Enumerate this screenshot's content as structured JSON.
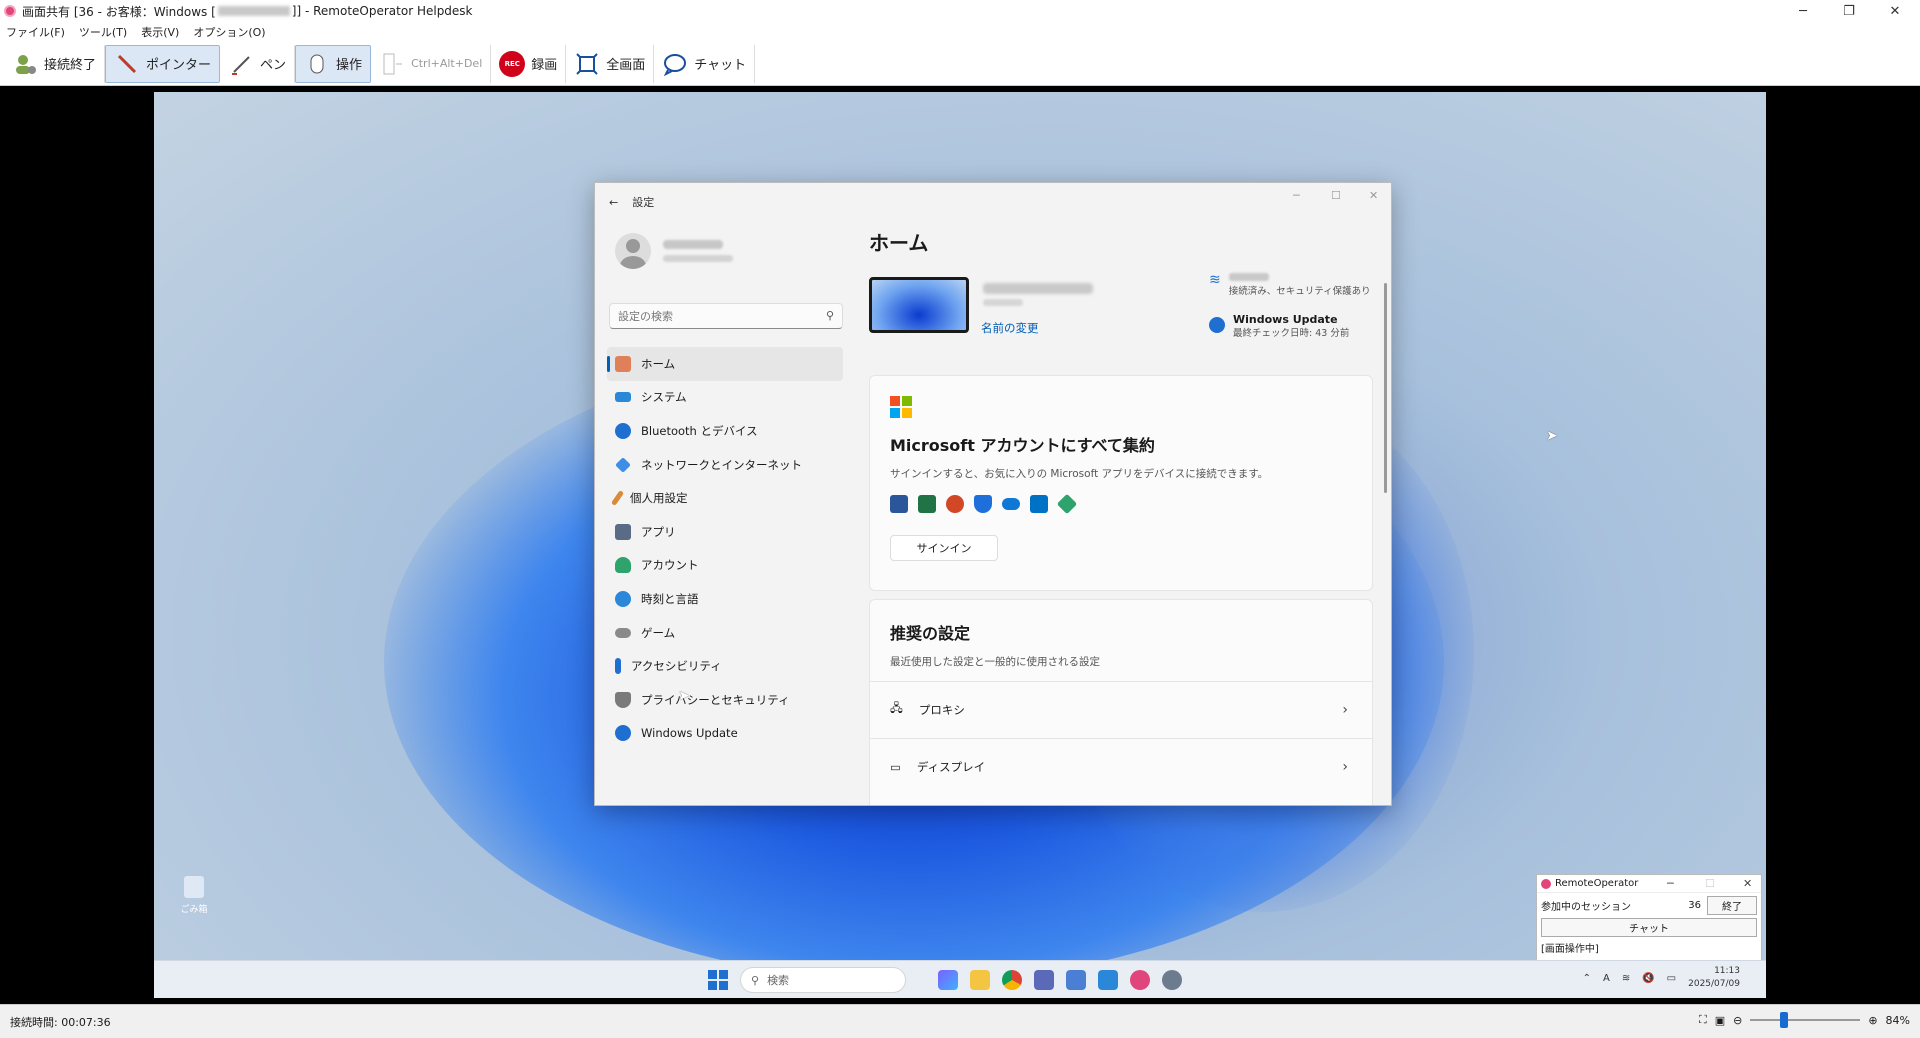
{
  "window": {
    "title": "画面共有 [36 - お客様：Windows [",
    "title_suffix": "]] - RemoteOperator Helpdesk",
    "controls": [
      "─",
      "❐",
      "✕"
    ]
  },
  "menu": [
    "ファイル(F)",
    "ツール(T)",
    "表示(V)",
    "オプション(O)"
  ],
  "toolbar": {
    "end": "接続終了",
    "pointer": "ポインター",
    "pen": "ペン",
    "operate": "操作",
    "cad": "Ctrl+Alt+Del",
    "rec_badge": "REC",
    "record": "録画",
    "fullscreen": "全画面",
    "chat": "チャット"
  },
  "desktop": {
    "recycle_label": "ごみ箱"
  },
  "settings": {
    "title": "設定",
    "back": "←",
    "search_placeholder": "設定の検索",
    "nav": [
      {
        "label": "ホーム",
        "color": "#e0805b"
      },
      {
        "label": "システム",
        "color": "#2b88d8"
      },
      {
        "label": "Bluetooth とデバイス",
        "color": "#1f6fd1"
      },
      {
        "label": "ネットワークとインターネット",
        "color": "#3e8ee6"
      },
      {
        "label": "個人用設定",
        "color": "#d98b3a"
      },
      {
        "label": "アプリ",
        "color": "#5a6b85"
      },
      {
        "label": "アカウント",
        "color": "#2ea36b"
      },
      {
        "label": "時刻と言語",
        "color": "#2b88d8"
      },
      {
        "label": "ゲーム",
        "color": "#8a8a8a"
      },
      {
        "label": "アクセシビリティ",
        "color": "#1f6fd1"
      },
      {
        "label": "プライバシーとセキュリティ",
        "color": "#7a7a7a"
      },
      {
        "label": "Windows Update",
        "color": "#1f6fd1"
      }
    ],
    "home_title": "ホーム",
    "rename": "名前の変更",
    "wifi_status": "接続済み、セキュリティ保護あり",
    "wu_title": "Windows Update",
    "wu_sub": "最終チェック日時: 43 分前",
    "ms_card": {
      "title": "Microsoft アカウントにすべて集約",
      "desc": "サインインすると、お気に入りの Microsoft アプリをデバイスに接続できます。",
      "signin": "サインイン",
      "logo_colors": [
        "#f25022",
        "#7fba00",
        "#00a4ef",
        "#ffb900"
      ],
      "app_colors": [
        "#2b579a",
        "#217346",
        "#d24726",
        "#1e6fd9",
        "#0f78d4",
        "#0072c6",
        "#2ea36b"
      ]
    },
    "rec_card": {
      "title": "推奨の設定",
      "desc": "最近使用した設定と一般的に使用される設定",
      "rows": [
        {
          "label": "プロキシ",
          "icon": "🖧"
        },
        {
          "label": "ディスプレイ",
          "icon": "▭"
        }
      ]
    }
  },
  "taskbar": {
    "search": "検索",
    "time": "11:13",
    "date": "2025/07/09"
  },
  "rop_panel": {
    "title": "RemoteOperator",
    "session_label": "参加中のセッション",
    "session_count": "36",
    "end": "終了",
    "chat": "チャット",
    "status": "[画面操作中]"
  },
  "status": {
    "elapsed": "接続時間: 00:07:36",
    "zoom": "84%"
  }
}
